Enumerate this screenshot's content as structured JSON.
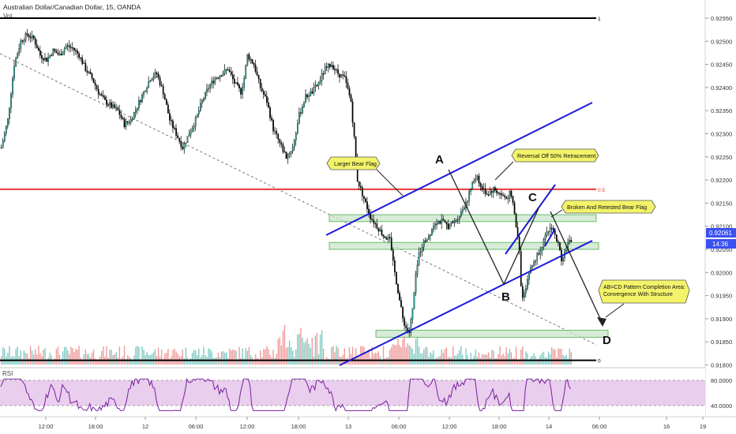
{
  "header": {
    "symbol_title": "Australian Dollar/Canadian Dollar, 15, OANDA",
    "vol_label": "Vol"
  },
  "rsi_label": "RSI",
  "chart_data": {
    "type": "candlestick",
    "symbol": "AUDCAD",
    "timeframe": "15",
    "ylim": [
      0.91745,
      0.92585
    ],
    "y_ticks": [
      "0.92550",
      "0.92500",
      "0.92450",
      "0.92400",
      "0.92350",
      "0.92300",
      "0.92250",
      "0.92200",
      "0.92150",
      "0.92100",
      "0.92050",
      "0.92000",
      "0.91950",
      "0.91900",
      "0.91850",
      "0.91800"
    ],
    "x_ticks": [
      "12:00",
      "18:00",
      "12",
      "06:00",
      "12:00",
      "18:00",
      "13",
      "06:00",
      "12:00",
      "18:00",
      "14",
      "06:00",
      "16",
      "19"
    ],
    "last_price": "0.92061",
    "countdown": "14:36",
    "close_path": [
      [
        0,
        0.9227
      ],
      [
        4,
        0.9233
      ],
      [
        8,
        0.9245
      ],
      [
        12,
        0.925
      ],
      [
        16,
        0.92515
      ],
      [
        20,
        0.92505
      ],
      [
        24,
        0.9247
      ],
      [
        28,
        0.9246
      ],
      [
        32,
        0.9248
      ],
      [
        36,
        0.9247
      ],
      [
        40,
        0.9249
      ],
      [
        44,
        0.92485
      ],
      [
        48,
        0.9247
      ],
      [
        52,
        0.9244
      ],
      [
        56,
        0.9242
      ],
      [
        60,
        0.9239
      ],
      [
        64,
        0.9237
      ],
      [
        68,
        0.9236
      ],
      [
        72,
        0.9235
      ],
      [
        76,
        0.9232
      ],
      [
        80,
        0.9233
      ],
      [
        84,
        0.9236
      ],
      [
        88,
        0.9239
      ],
      [
        92,
        0.9242
      ],
      [
        96,
        0.9243
      ],
      [
        100,
        0.9239
      ],
      [
        104,
        0.9233
      ],
      [
        108,
        0.923
      ],
      [
        112,
        0.9227
      ],
      [
        116,
        0.923
      ],
      [
        120,
        0.9233
      ],
      [
        124,
        0.9237
      ],
      [
        128,
        0.924
      ],
      [
        132,
        0.9242
      ],
      [
        136,
        0.9243
      ],
      [
        140,
        0.9244
      ],
      [
        144,
        0.9241
      ],
      [
        148,
        0.9239
      ],
      [
        150,
        0.9242
      ],
      [
        152,
        0.9247
      ],
      [
        156,
        0.9245
      ],
      [
        160,
        0.924
      ],
      [
        164,
        0.9237
      ],
      [
        168,
        0.9231
      ],
      [
        172,
        0.9228
      ],
      [
        176,
        0.9225
      ],
      [
        180,
        0.9227
      ],
      [
        184,
        0.9234
      ],
      [
        188,
        0.9238
      ],
      [
        192,
        0.9239
      ],
      [
        196,
        0.9241
      ],
      [
        200,
        0.9244
      ],
      [
        204,
        0.9245
      ],
      [
        208,
        0.9243
      ],
      [
        212,
        0.9242
      ],
      [
        216,
        0.9237
      ],
      [
        218,
        0.9229
      ],
      [
        220,
        0.922
      ],
      [
        224,
        0.9216
      ],
      [
        228,
        0.9212
      ],
      [
        232,
        0.921
      ],
      [
        236,
        0.9208
      ],
      [
        240,
        0.9207
      ],
      [
        242,
        0.9202
      ],
      [
        244,
        0.9198
      ],
      [
        246,
        0.9194
      ],
      [
        248,
        0.919
      ],
      [
        250,
        0.9188
      ],
      [
        252,
        0.9187
      ],
      [
        254,
        0.9192
      ],
      [
        256,
        0.9199
      ],
      [
        258,
        0.9204
      ],
      [
        260,
        0.9206
      ],
      [
        264,
        0.9208
      ],
      [
        268,
        0.9211
      ],
      [
        272,
        0.9211
      ],
      [
        276,
        0.921
      ],
      [
        280,
        0.9211
      ],
      [
        284,
        0.9213
      ],
      [
        288,
        0.9216
      ],
      [
        292,
        0.922
      ],
      [
        294,
        0.9221
      ],
      [
        296,
        0.92185
      ],
      [
        300,
        0.9217
      ],
      [
        304,
        0.9218
      ],
      [
        308,
        0.9217
      ],
      [
        312,
        0.9216
      ],
      [
        314,
        0.9217
      ],
      [
        316,
        0.9215
      ],
      [
        318,
        0.921
      ],
      [
        320,
        0.9205
      ],
      [
        321,
        0.9197
      ],
      [
        322,
        0.9195
      ],
      [
        324,
        0.9197
      ],
      [
        326,
        0.92
      ],
      [
        330,
        0.9203
      ],
      [
        334,
        0.9206
      ],
      [
        338,
        0.9209
      ],
      [
        340,
        0.921
      ],
      [
        342,
        0.9208
      ],
      [
        344,
        0.9206
      ],
      [
        346,
        0.9203
      ],
      [
        348,
        0.92045
      ],
      [
        350,
        0.9206
      ],
      [
        352,
        0.9207
      ]
    ],
    "horizontal_levels": [
      {
        "label": "1",
        "value": 0.9255,
        "color": "#000000"
      },
      {
        "label": "0.5",
        "value": 0.9218,
        "color": "#e53935"
      },
      {
        "label": "0",
        "value": 0.9181,
        "color": "#000000"
      }
    ],
    "zones": [
      {
        "from": 0.9211,
        "to": 0.92125
      },
      {
        "from": 0.9205,
        "to": 0.92065
      },
      {
        "from": 0.9186,
        "to": 0.91875
      }
    ],
    "pattern_points": [
      "A",
      "B",
      "C",
      "D"
    ],
    "annotations": [
      "Larger Bear Flag",
      "Reversal Off 50% Retracement",
      "Broken And Retested Bear Flag",
      "AB=CD Pattern Completion Area: Convergence With Structure"
    ],
    "rsi": {
      "levels": [
        "80.0000",
        "40.0000"
      ],
      "range": [
        25,
        95
      ]
    }
  },
  "colors": {
    "candle_up": "#26a69a",
    "candle_down": "#ef5350",
    "candle_neutral": "#000000",
    "channel": "#1a1ad6",
    "zone_fill": "#c8e6c9",
    "zone_stroke": "#4caf50",
    "label_bg": "#f3f36a",
    "rsi_bg": "#e1bee7",
    "rsi_line": "#7b1fa2",
    "price_tag": "#3a50f0"
  }
}
